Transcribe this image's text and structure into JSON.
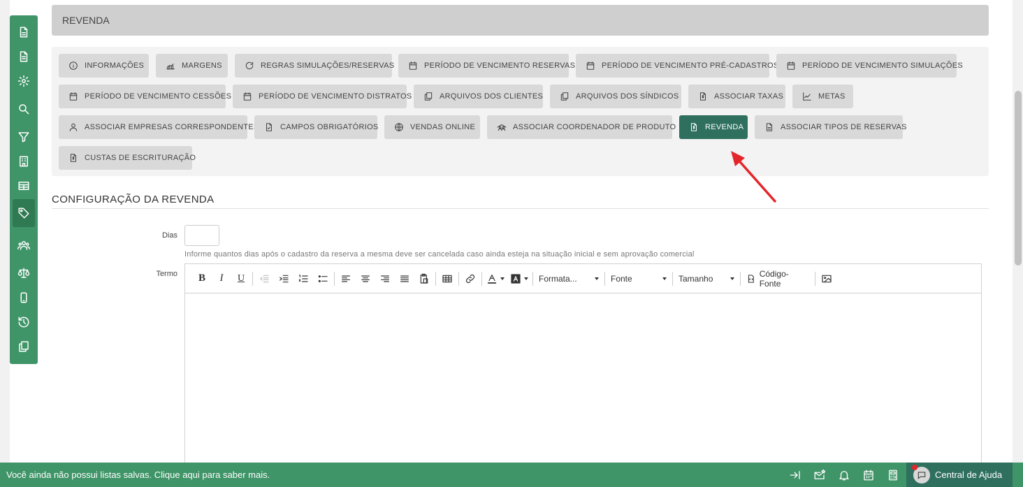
{
  "header": {
    "title": "REVENDA"
  },
  "tabs": [
    {
      "label": "INFORMAÇÕES",
      "icon": "info-icon"
    },
    {
      "label": "MARGENS",
      "icon": "margins-icon"
    },
    {
      "label": "REGRAS SIMULAÇÕES/RESERVAS",
      "icon": "refresh-icon"
    },
    {
      "label": "PERÍODO DE VENCIMENTO RESERVAS",
      "icon": "calendar-icon"
    },
    {
      "label": "PERÍODO DE VENCIMENTO PRÉ-CADASTROS",
      "icon": "calendar-icon"
    },
    {
      "label": "PERÍODO DE VENCIMENTO SIMULAÇÕES",
      "icon": "calendar-icon"
    },
    {
      "label": "PERÍODO DE VENCIMENTO CESSÕES",
      "icon": "calendar-icon"
    },
    {
      "label": "PERÍODO DE VENCIMENTO DISTRATOS",
      "icon": "calendar-icon"
    },
    {
      "label": "ARQUIVOS DOS CLIENTES",
      "icon": "files-icon"
    },
    {
      "label": "ARQUIVOS DOS SÍNDICOS",
      "icon": "files-icon"
    },
    {
      "label": "ASSOCIAR TAXAS",
      "icon": "invoice-icon"
    },
    {
      "label": "METAS",
      "icon": "chart-line-icon"
    },
    {
      "label": "ASSOCIAR EMPRESAS CORRESPONDENTES",
      "icon": "user-icon"
    },
    {
      "label": "CAMPOS OBRIGATÓRIOS",
      "icon": "doc-check-icon"
    },
    {
      "label": "VENDAS ONLINE",
      "icon": "globe-icon"
    },
    {
      "label": "ASSOCIAR COORDENADOR DE PRODUTO",
      "icon": "team-icon"
    },
    {
      "label": "REVENDA",
      "icon": "doc-dollar-icon",
      "active": true
    },
    {
      "label": "ASSOCIAR TIPOS DE RESERVAS",
      "icon": "doc-icon"
    },
    {
      "label": "CUSTAS DE ESCRITURAÇÃO",
      "icon": "doc-dollar-icon"
    }
  ],
  "section": {
    "title": "CONFIGURAÇÃO DA REVENDA"
  },
  "form": {
    "days_label": "Dias",
    "days_value": "",
    "days_hint": "Informe quantos dias após o cadastro da reserva a mesma deve ser cancelada caso ainda esteja na situação inicial e sem aprovação comercial",
    "term_label": "Termo"
  },
  "editor": {
    "format_label": "Formata...",
    "font_label": "Fonte",
    "size_label": "Tamanho",
    "source_label": "Código-Fonte",
    "content": ""
  },
  "sidebar_icons": [
    "doc-icon",
    "doc-icon",
    "gear-icon",
    "search-icon",
    "filter-icon",
    "building-icon",
    "table-icon",
    "tag-icon",
    "people-icon",
    "scale-icon",
    "phone-icon",
    "history-icon",
    "copy-icon"
  ],
  "bottom_bar": {
    "message": "Você ainda não possui listas salvas. Clique aqui para saber mais.",
    "help_label": "Central de Ajuda"
  },
  "colors": {
    "brand_green": "#3f9468",
    "active_tab": "#2f6f5e",
    "annotation_arrow": "#e3262b"
  }
}
